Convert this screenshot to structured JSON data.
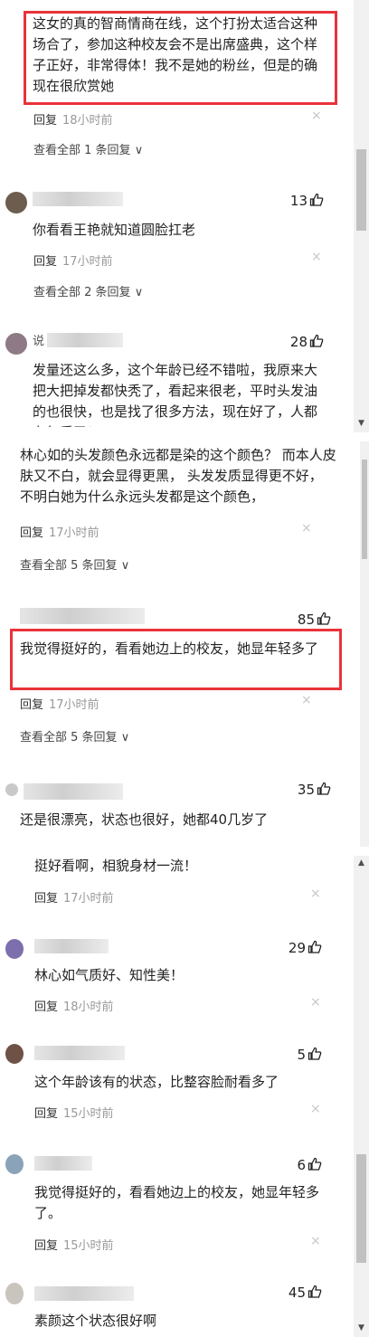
{
  "panel1": {
    "c1": {
      "text": "这女的真的智商情商在线，这个打扮太适合这种场合了，参加这种校友会不是出席盛典，这个样子正好，非常得体！我不是她的粉丝，但是的确现在很欣赏她",
      "reply": "回复",
      "time": "18小时前",
      "expand": "查看全部 1 条回复"
    },
    "c2": {
      "likes": "13",
      "text": "你看看王艳就知道圆脸扛老",
      "reply": "回复",
      "time": "17小时前",
      "expand": "查看全部 2 条回复"
    },
    "c3": {
      "name": "说",
      "likes": "28",
      "text": "发量还这么多，这个年龄已经不错啦，我原来大把大把掉发都快秃了，看起来很老，平时头发油的也很快，也是找了很多方法，现在好了，人都有气质了！"
    }
  },
  "panel2": {
    "c1": {
      "text": "林心如的头发颜色永远都是染的这个颜色？ 而本人皮肤又不白，就会显得更黑， 头发发质显得更不好， 不明白她为什么永远头发都是这个颜色，",
      "reply": "回复",
      "time": "17小时前",
      "expand": "查看全部 5 条回复"
    },
    "c2": {
      "likes": "85",
      "text": "我觉得挺好的，看看她边上的校友，她显年轻多了",
      "reply": "回复",
      "time": "17小时前",
      "expand": "查看全部 5 条回复"
    },
    "c3": {
      "likes": "35",
      "text": "还是很漂亮，状态也很好，她都40几岁了"
    }
  },
  "panel3": {
    "c1": {
      "text": "挺好看啊，相貌身材一流！",
      "reply": "回复",
      "time": "17小时前"
    },
    "c2": {
      "likes": "29",
      "text": "林心如气质好、知性美！",
      "reply": "回复",
      "time": "18小时前"
    },
    "c3": {
      "likes": "5",
      "text": "这个年龄该有的状态，比整容脸耐看多了",
      "reply": "回复",
      "time": "15小时前"
    },
    "c4": {
      "likes": "6",
      "text": "我觉得挺好的，看看她边上的校友，她显年轻多了。",
      "reply": "回复",
      "time": "15小时前"
    },
    "c5": {
      "likes": "45",
      "text": "素颜这个状态很好啊"
    }
  },
  "icons": {
    "close": "×",
    "expand_chevron": "∨",
    "scroll_up": "▲",
    "scroll_down": "▼",
    "like": "thumbs-up-icon"
  },
  "colors": {
    "highlight": "#e8333a",
    "time": "#999999"
  }
}
